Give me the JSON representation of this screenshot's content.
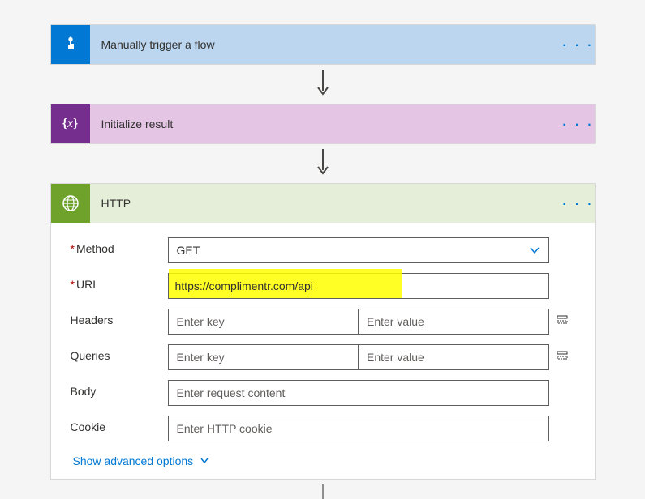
{
  "cards": {
    "trigger": {
      "title": "Manually trigger a flow"
    },
    "init": {
      "title": "Initialize result"
    },
    "http": {
      "title": "HTTP",
      "fields": {
        "method": {
          "label": "Method",
          "value": "GET"
        },
        "uri": {
          "label": "URI",
          "value": "https://complimentr.com/api"
        },
        "headers": {
          "label": "Headers",
          "key_placeholder": "Enter key",
          "value_placeholder": "Enter value"
        },
        "queries": {
          "label": "Queries",
          "key_placeholder": "Enter key",
          "value_placeholder": "Enter value"
        },
        "body": {
          "label": "Body",
          "placeholder": "Enter request content"
        },
        "cookie": {
          "label": "Cookie",
          "placeholder": "Enter HTTP cookie"
        }
      },
      "show_advanced": "Show advanced options"
    }
  }
}
